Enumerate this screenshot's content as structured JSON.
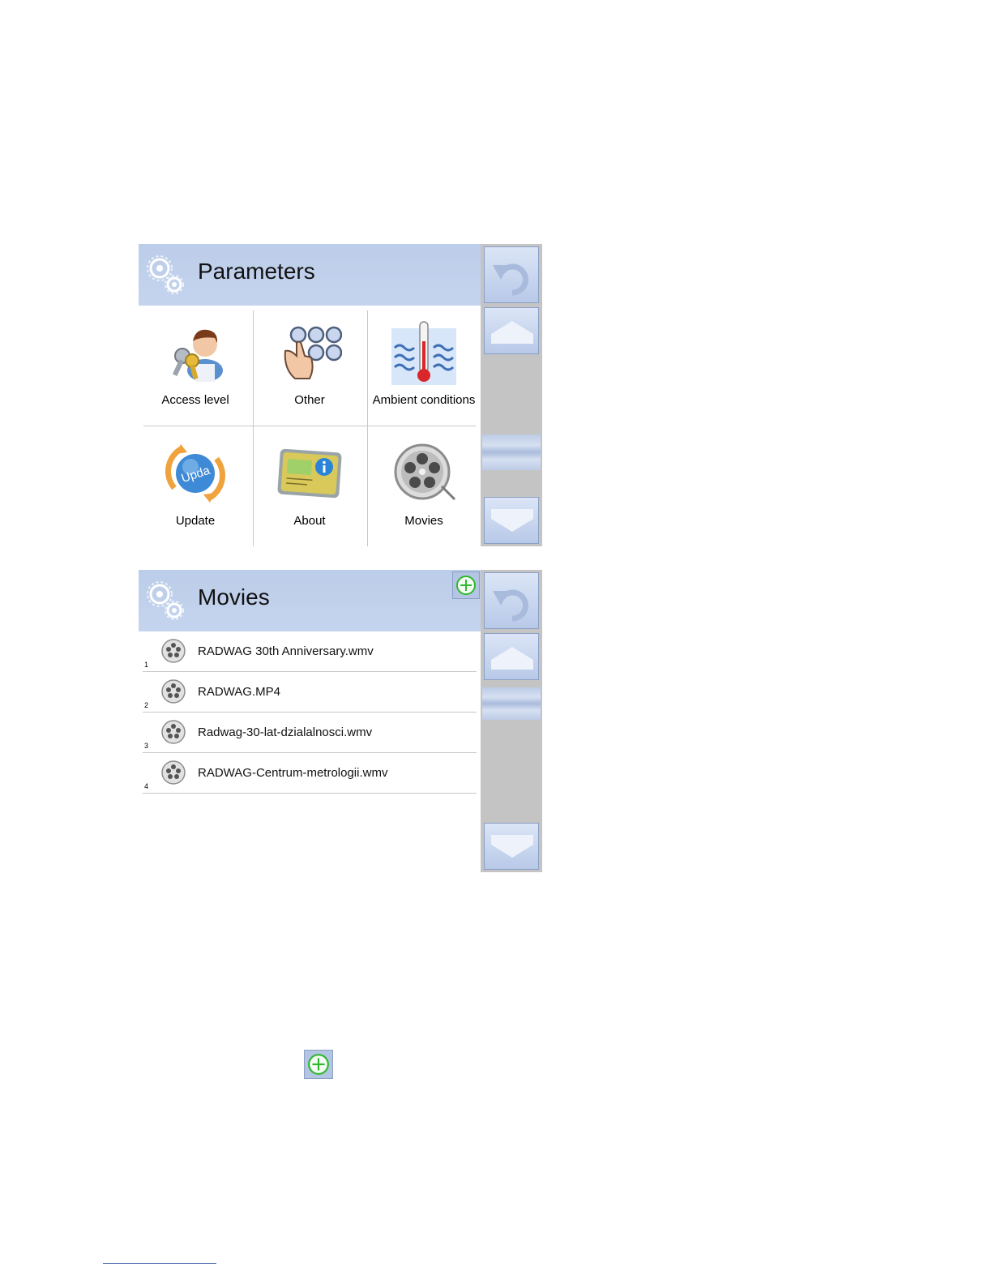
{
  "parameters_panel": {
    "title": "Parameters",
    "tiles": [
      {
        "label": "Access level",
        "icon": "access-level-icon"
      },
      {
        "label": "Other",
        "icon": "keypad-hand-icon"
      },
      {
        "label": "Ambient conditions",
        "icon": "thermometer-icon"
      },
      {
        "label": "Update",
        "icon": "update-icon"
      },
      {
        "label": "About",
        "icon": "info-card-icon"
      },
      {
        "label": "Movies",
        "icon": "film-reel-icon"
      }
    ]
  },
  "movies_panel": {
    "title": "Movies",
    "items": [
      {
        "number": "1",
        "name": "RADWAG 30th Anniversary.wmv"
      },
      {
        "number": "2",
        "name": "RADWAG.MP4"
      },
      {
        "number": "3",
        "name": "Radwag-30-lat-dzialalnosci.wmv"
      },
      {
        "number": "4",
        "name": "RADWAG-Centrum-metrologii.wmv"
      }
    ]
  },
  "colors": {
    "header_bg": "#bccde9",
    "sidebar_bg": "#c4c4c4",
    "button_bg": "#c9d7ef",
    "add_icon": "#2eb82e"
  }
}
